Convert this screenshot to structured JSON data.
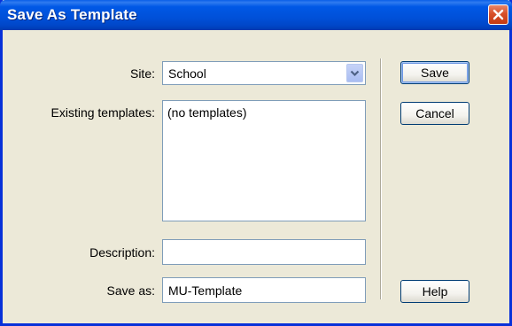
{
  "window": {
    "title": "Save As Template"
  },
  "form": {
    "site_label": "Site:",
    "site_value": "School",
    "existing_label": "Existing templates:",
    "existing_items": [
      "(no templates)"
    ],
    "description_label": "Description:",
    "description_value": "",
    "saveas_label": "Save as:",
    "saveas_value": "MU-Template"
  },
  "buttons": {
    "save": "Save",
    "cancel": "Cancel",
    "help": "Help"
  },
  "icons": {
    "close": "close-icon",
    "dropdown": "chevron-down-icon"
  },
  "colors": {
    "titlebar": "#0054e3",
    "window_bg": "#ece9d8",
    "close_button": "#d8502a",
    "field_border": "#7f9db9"
  }
}
